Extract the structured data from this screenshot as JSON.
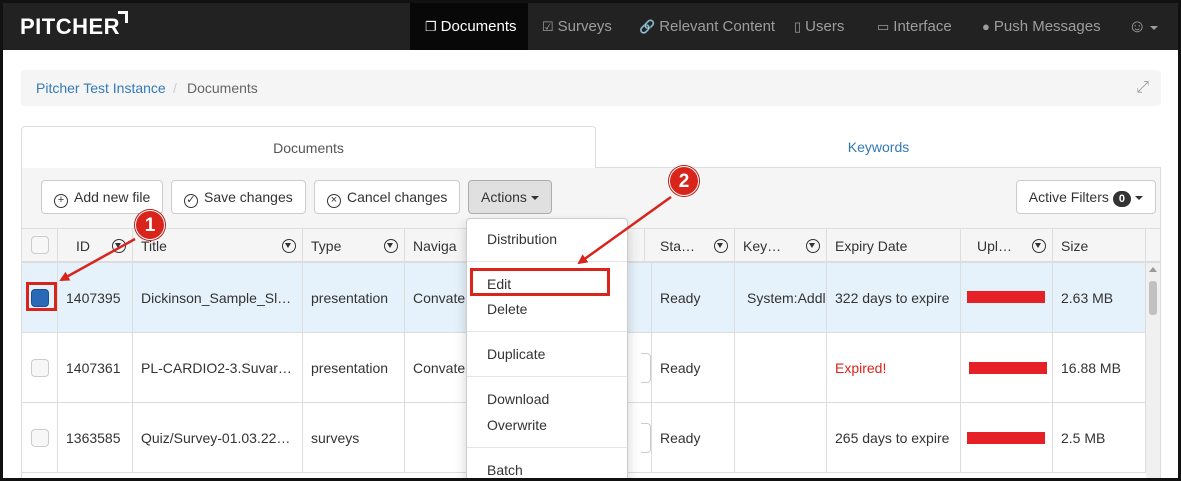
{
  "app": {
    "brand": "PITCHER"
  },
  "nav": {
    "items": [
      {
        "label": "Documents",
        "icon": "documents-icon",
        "active": true
      },
      {
        "label": "Surveys",
        "icon": "check-square-icon"
      },
      {
        "label": "Relevant Content",
        "icon": "link-icon"
      },
      {
        "label": "Users",
        "icon": "tablet-icon"
      },
      {
        "label": "Interface",
        "icon": "monitor-icon"
      },
      {
        "label": "Push Messages",
        "icon": "chat-bubble-icon"
      }
    ],
    "user_icon": "user-circle-icon"
  },
  "breadcrumb": {
    "root": "Pitcher Test Instance",
    "separator": "/",
    "current": "Documents"
  },
  "tabs": [
    {
      "label": "Documents",
      "active": true
    },
    {
      "label": "Keywords"
    }
  ],
  "toolbar": {
    "add": "Add new file",
    "save": "Save changes",
    "cancel": "Cancel changes",
    "actions": "Actions",
    "filters": "Active Filters",
    "filter_count": "0"
  },
  "table": {
    "columns": [
      "ID",
      "Title",
      "Type",
      "Naviga",
      "Sta…",
      "Key…",
      "Expiry Date",
      "Upl…",
      "Size"
    ],
    "rows": [
      {
        "id": "1407395",
        "title": "Dickinson_Sample_Sl…",
        "type": "presentation",
        "nav": "Convate",
        "status": "Ready",
        "keywords": "System:Addl",
        "expiry": "322 days to expire",
        "size": "2.63 MB",
        "selected": true,
        "expired": false
      },
      {
        "id": "1407361",
        "title": "PL-CARDIO2-3.Suvar…",
        "type": "presentation",
        "nav": "Convate",
        "status": "Ready",
        "keywords": "",
        "expiry": "Expired!",
        "size": "16.88 MB",
        "selected": false,
        "expired": true
      },
      {
        "id": "1363585",
        "title": "Quiz/Survey-01.03.22…",
        "type": "surveys",
        "nav": "",
        "status": "Ready",
        "keywords": "",
        "expiry": "265 days to expire",
        "size": "2.5 MB",
        "selected": false,
        "expired": false
      }
    ]
  },
  "actions_menu": [
    "Distribution",
    "Edit",
    "Delete",
    "Duplicate",
    "Download",
    "Overwrite",
    "Batch"
  ],
  "annotations": {
    "step1": "1",
    "step2": "2",
    "color": "#d9241c"
  }
}
